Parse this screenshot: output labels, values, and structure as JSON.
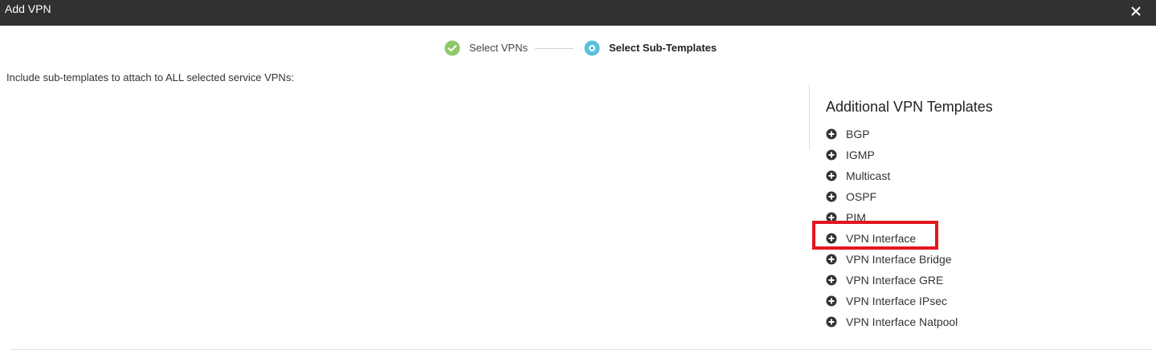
{
  "window": {
    "title": "Add VPN",
    "close_icon": "close-icon"
  },
  "stepper": {
    "steps": [
      {
        "label": "Select VPNs",
        "status": "complete",
        "icon": "check-circle-icon",
        "color": "#8dc86b"
      },
      {
        "label": "Select Sub-Templates",
        "status": "active",
        "icon": "active-step-icon",
        "color": "#5bc0de"
      }
    ]
  },
  "main": {
    "instruction": "Include sub-templates to attach to ALL selected service VPNs:"
  },
  "templates_panel": {
    "heading": "Additional VPN Templates",
    "items": [
      {
        "label": "BGP",
        "icon": "plus-circle-icon"
      },
      {
        "label": "IGMP",
        "icon": "plus-circle-icon"
      },
      {
        "label": "Multicast",
        "icon": "plus-circle-icon"
      },
      {
        "label": "OSPF",
        "icon": "plus-circle-icon"
      },
      {
        "label": "PIM",
        "icon": "plus-circle-icon"
      },
      {
        "label": "VPN Interface",
        "icon": "plus-circle-icon",
        "highlighted": true
      },
      {
        "label": "VPN Interface Bridge",
        "icon": "plus-circle-icon"
      },
      {
        "label": "VPN Interface GRE",
        "icon": "plus-circle-icon"
      },
      {
        "label": "VPN Interface IPsec",
        "icon": "plus-circle-icon"
      },
      {
        "label": "VPN Interface Natpool",
        "icon": "plus-circle-icon"
      }
    ],
    "highlight_color": "#e3161e"
  }
}
